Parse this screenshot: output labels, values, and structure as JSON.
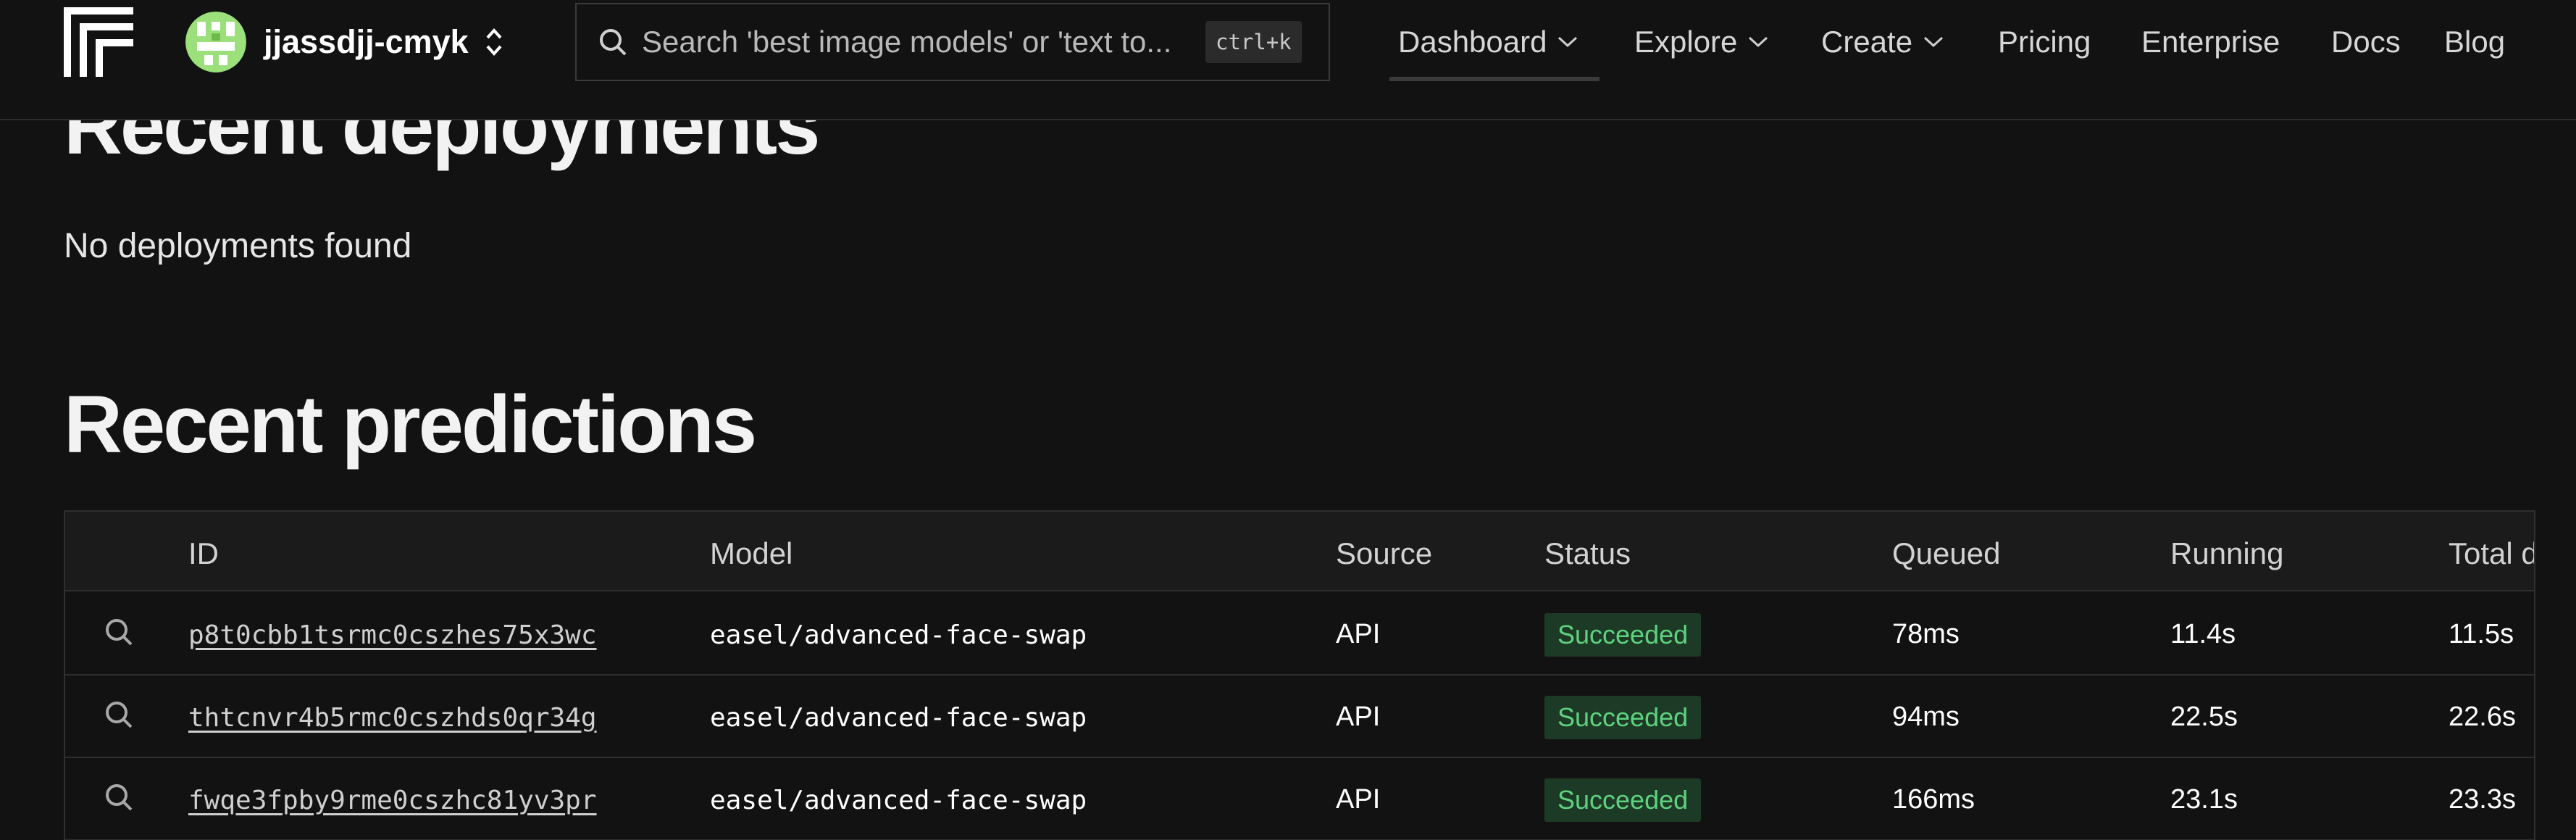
{
  "account": {
    "name": "jjassdjj-cmyk"
  },
  "search": {
    "placeholder": "Search 'best image models' or 'text to...",
    "shortcut": "ctrl+k"
  },
  "nav": {
    "dashboard": "Dashboard",
    "explore": "Explore",
    "create": "Create",
    "pricing": "Pricing",
    "enterprise": "Enterprise",
    "docs": "Docs",
    "blog": "Blog"
  },
  "deployments": {
    "title": "Recent deployments",
    "empty": "No deployments found"
  },
  "predictions": {
    "title": "Recent predictions",
    "columns": {
      "id": "ID",
      "model": "Model",
      "source": "Source",
      "status": "Status",
      "queued": "Queued",
      "running": "Running",
      "total": "Total d"
    },
    "rows": [
      {
        "id": "p8t0cbb1tsrmc0cszhes75x3wc",
        "model": "easel/advanced-face-swap",
        "source": "API",
        "status": "Succeeded",
        "queued": "78ms",
        "running": "11.4s",
        "total": "11.5s"
      },
      {
        "id": "thtcnvr4b5rmc0cszhds0qr34g",
        "model": "easel/advanced-face-swap",
        "source": "API",
        "status": "Succeeded",
        "queued": "94ms",
        "running": "22.5s",
        "total": "22.6s"
      },
      {
        "id": "fwqe3fpby9rme0cszhc81yv3pr",
        "model": "easel/advanced-face-swap",
        "source": "API",
        "status": "Succeeded",
        "queued": "166ms",
        "running": "23.1s",
        "total": "23.3s"
      }
    ]
  },
  "colors": {
    "background": "#121212",
    "status_success_bg": "#1d3a26",
    "status_success_text": "#5fd27f",
    "avatar_green": "#9be07a"
  },
  "icons": {
    "logo": "replicate-logo",
    "search": "search-icon",
    "account_switch": "chevron-up-down-icon",
    "dropdown": "chevron-down-icon",
    "row_inspect": "search-icon"
  }
}
